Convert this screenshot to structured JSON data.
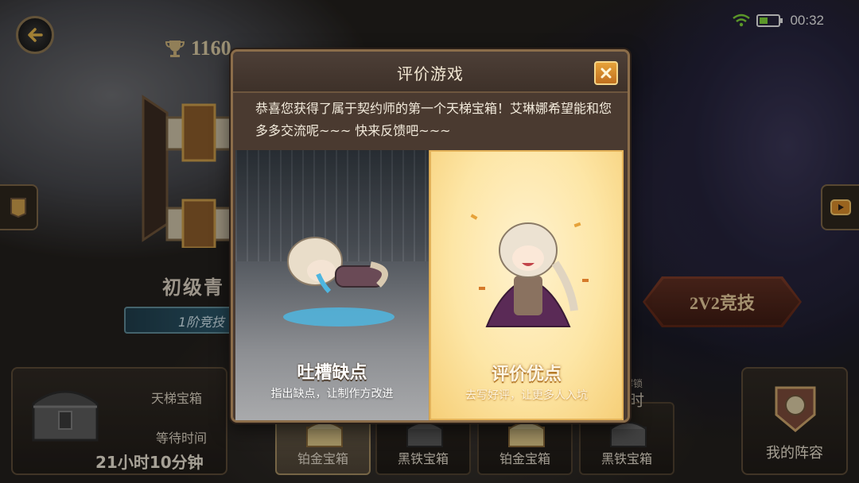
{
  "status_bar": {
    "time": "00:32"
  },
  "header": {
    "trophy_value": "1160"
  },
  "background": {
    "rank_title": "初级青",
    "rank_sub": "1阶竞技",
    "v2_button": "2V2竞技"
  },
  "chest_panel": {
    "name": "天梯宝箱",
    "wait_label": "等待时间",
    "wait_time": "21小时10分钟"
  },
  "slots": [
    {
      "label": "铂金宝箱",
      "active": true
    },
    {
      "label": "黑铁宝箱",
      "active": false
    },
    {
      "label": "铂金宝箱",
      "active": false
    },
    {
      "label": "黑铁宝箱",
      "active": false
    }
  ],
  "slot_fragments": {
    "unlock": "解锁",
    "time": "时"
  },
  "lineup": {
    "label": "我的阵容"
  },
  "modal": {
    "title": "评价游戏",
    "message": "恭喜您获得了属于契约师的第一个天梯宝箱！艾琳娜希望能和您多多交流呢~~~ 快来反馈吧~~~",
    "left_option": {
      "title": "吐槽缺点",
      "subtitle": "指出缺点，让制作方改进"
    },
    "right_option": {
      "title": "评价优点",
      "subtitle": "去写好评，让更多人入坑"
    }
  },
  "colors": {
    "accent_gold": "#e6a23a",
    "frame_brown": "#8b6d4a",
    "modal_bg": "#4a3a30"
  }
}
